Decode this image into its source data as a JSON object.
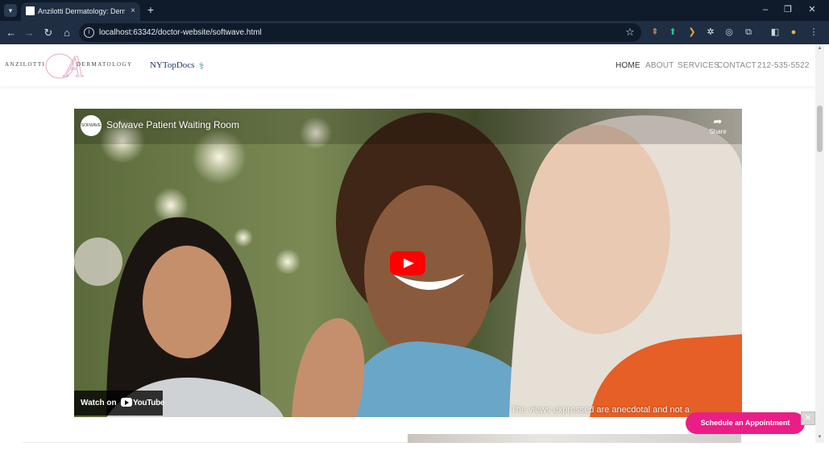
{
  "browser": {
    "tab_title": "Anzilotti Dermatology: Dermato",
    "tab_close": "×",
    "new_tab": "+",
    "url": "localhost:63342/doctor-website/softwave.html",
    "window_controls": [
      "–",
      "❐",
      "✕"
    ],
    "nav_icons": [
      "arrow-left-icon",
      "arrow-right-icon",
      "reload-icon",
      "home-icon"
    ],
    "extension_icons": [
      "ext-1-icon",
      "ext-2-icon",
      "ext-3-icon",
      "ext-4-icon",
      "ext-5-icon",
      "extensions-icon",
      "sidepanel-icon",
      "profile-icon",
      "menu-icon"
    ]
  },
  "site": {
    "logo": {
      "left_word": "ANZILOTTI",
      "monogram": "A",
      "right_word": "DERMATOLOGY"
    },
    "partner_logo": "NYTopDocs",
    "nav": [
      {
        "label": "HOME",
        "active": true
      },
      {
        "label": "ABOUT",
        "active": false
      },
      {
        "label": "SERVICES",
        "active": false
      },
      {
        "label": "CONTACT",
        "active": false
      },
      {
        "label": "212-535-5522",
        "active": false
      }
    ]
  },
  "video": {
    "channel_badge": "SOFWAVE",
    "title": "Sofwave Patient Waiting Room",
    "share_label": "Share",
    "watch_on_label": "Watch on",
    "youtube_label": "YouTube",
    "caption": "The views expressed are anecdotal and not a"
  },
  "cta": {
    "label": "Schedule an Appointment",
    "close": "✕"
  },
  "colors": {
    "accent": "#ea1e86",
    "browser_bg": "#0f1b2a",
    "toolbar_bg": "#1f2e42",
    "youtube_red": "#ff0000"
  }
}
